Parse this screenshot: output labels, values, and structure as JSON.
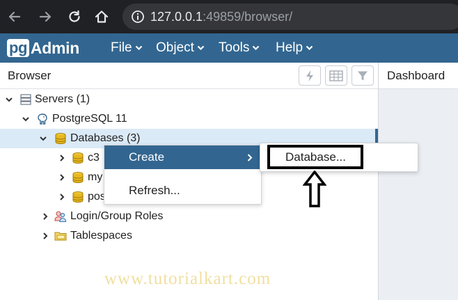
{
  "browser": {
    "url_host": "127.0.0.1",
    "url_rest": ":49859/browser/"
  },
  "app": {
    "logo_pg": "pg",
    "logo_admin": "Admin",
    "menu": [
      {
        "label": "File"
      },
      {
        "label": "Object"
      },
      {
        "label": "Tools"
      },
      {
        "label": "Help"
      }
    ]
  },
  "panels": {
    "browser_title": "Browser",
    "dashboard_title": "Dashboard"
  },
  "tree": {
    "servers": "Servers (1)",
    "server": "PostgreSQL 11",
    "databases": "Databases (3)",
    "db_items": [
      "c3",
      "my",
      "pos"
    ],
    "login_roles": "Login/Group Roles",
    "tablespaces": "Tablespaces"
  },
  "context_menu": {
    "create": "Create",
    "refresh": "Refresh...",
    "submenu_database": "Database..."
  },
  "watermark": "www.tutorialkart.com",
  "colors": {
    "chrome_bg": "#202124",
    "pgadmin_blue": "#326690",
    "selected_row": "#dbeaf7",
    "db_icon": "#e6b820"
  }
}
